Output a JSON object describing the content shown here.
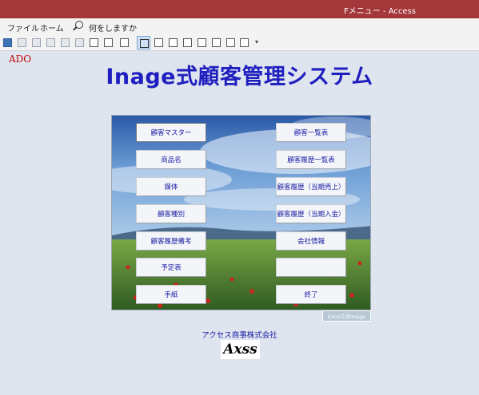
{
  "window": {
    "title": "Fメニュー - Access"
  },
  "menu": {
    "file": "ファイル",
    "home": "ホーム",
    "tell_me": "何をしますか"
  },
  "badge": {
    "ado": "ADO"
  },
  "app": {
    "title": "Inage式顧客管理システム"
  },
  "buttons": {
    "customer_master": "顧客マスター",
    "product_name": "商品名",
    "media": "媒体",
    "customer_type": "顧客種別",
    "history_notes": "顧客履歴備考",
    "schedule": "予定表",
    "letter": "手紙",
    "customer_list": "顧客一覧表",
    "history_list": "顧客履歴一覧表",
    "history_sales": "顧客履歴（当期売上）",
    "history_deposits": "顧客履歴（当期入金）",
    "company_info": "会社情報",
    "blank": "",
    "exit": "終了"
  },
  "footer": {
    "credit": "Excel工房Image",
    "company": "アクセス商事株式会社",
    "logo_text": "Axss"
  },
  "icons": [
    "save-icon",
    "undo-icon",
    "redo-icon",
    "form-view-icon",
    "design-view-icon",
    "print-preview-icon",
    "customize-toolbar-icon"
  ],
  "colors": {
    "title_bar": "#a4373a",
    "app_title": "#1f1fbf",
    "ado_badge": "#c00000",
    "button_text": "#1a1aa6",
    "background": "#dfe5ee"
  }
}
